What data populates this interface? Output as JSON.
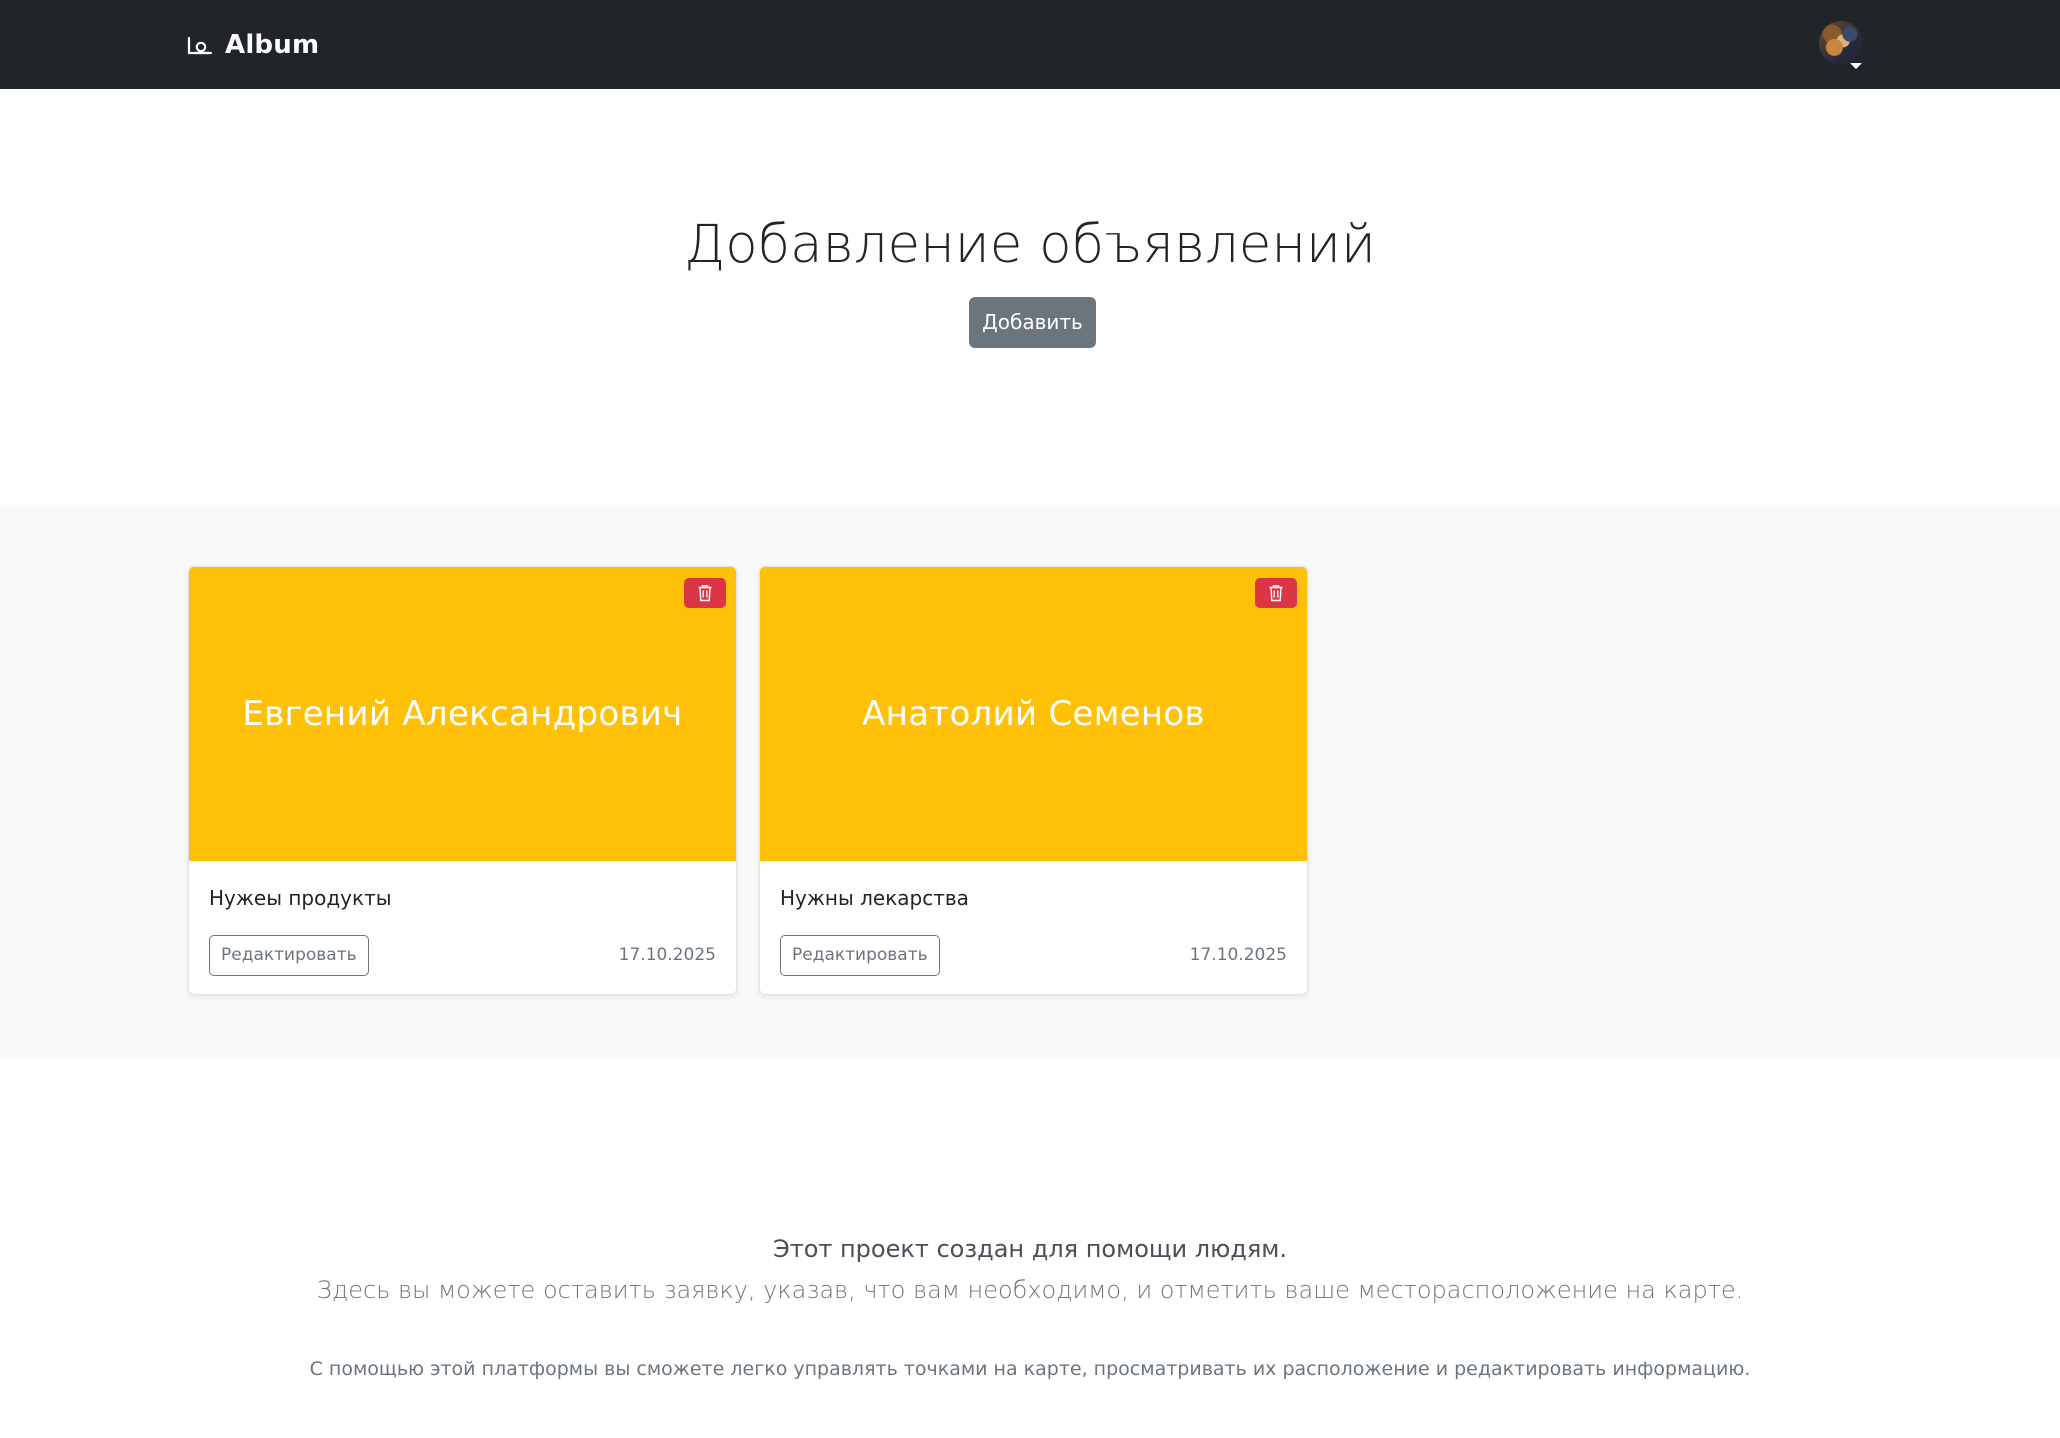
{
  "navbar": {
    "brand": "Album",
    "brand_icon": "camera-icon",
    "avatar_icon": "user-avatar",
    "dropdown_icon": "caret-down-icon",
    "background": "#212529"
  },
  "hero": {
    "title": "Добавление объявлений",
    "add_button": "Добавить"
  },
  "cards": [
    {
      "image_text": "Евгений Александрович",
      "text": "Нужеы продукты",
      "edit_button": "Редактировать",
      "date": "17.10.2025",
      "delete_icon": "trash-icon"
    },
    {
      "image_text": "Анатолий Семенов",
      "text": "Нужны лекарства",
      "edit_button": "Редактировать",
      "date": "17.10.2025",
      "delete_icon": "trash-icon"
    }
  ],
  "about": {
    "lead": "Этот проект создан для помощи людям.",
    "sub": "Здесь вы можете оставить заявку, указав, что вам необходимо, и отметить ваше месторасположение на карте.",
    "small": "С помощью этой платформы вы сможете легко управлять точками на карте, просматривать их расположение и редактировать информацию."
  },
  "colors": {
    "card_image": "#ffc107",
    "delete_button": "#dc3545",
    "secondary": "#6c757d",
    "album_background": "#f8f9fa"
  }
}
